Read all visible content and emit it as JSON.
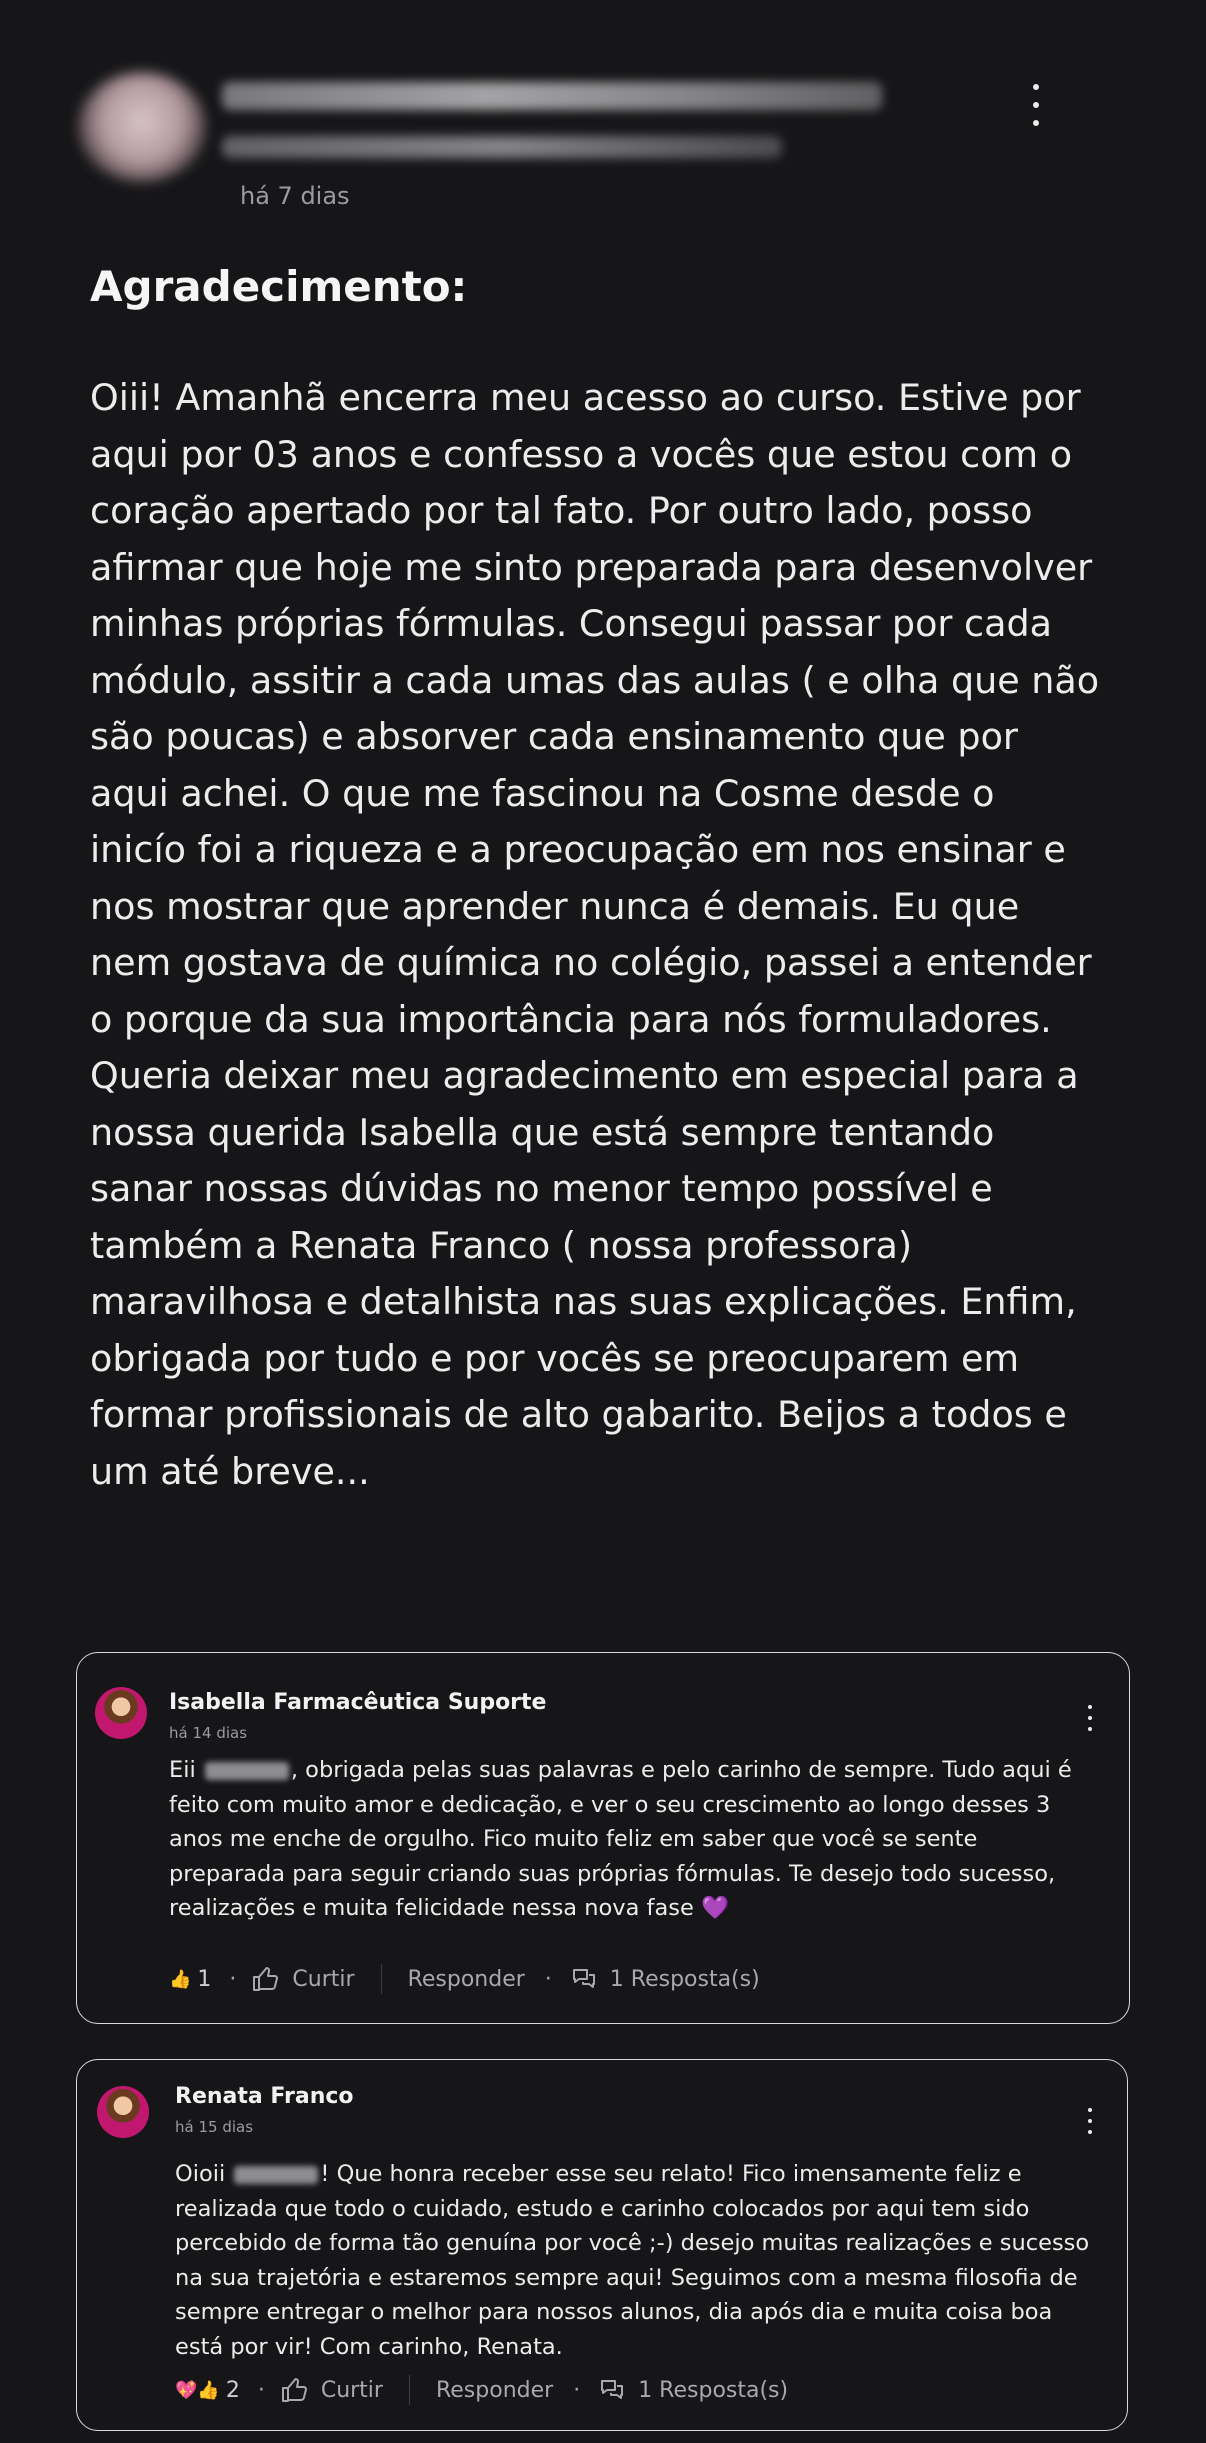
{
  "post": {
    "time": "há 7 dias",
    "title": "Agradecimento:",
    "body": "Oiii! Amanhã encerra meu acesso ao curso. Estive por aqui por 03 anos e confesso a vocês que estou com o coração apertado por tal fato. Por outro lado, posso afirmar que hoje me sinto preparada para desenvolver minhas próprias fórmulas. Consegui passar por cada módulo, assitir a cada umas das aulas ( e olha que não são poucas) e absorver cada ensinamento que por aqui achei. O que me fascinou na Cosme desde o inicío foi a riqueza e a preocupação em nos ensinar e nos mostrar que aprender nunca é demais. Eu que nem gostava de química no colégio, passei a entender o porque da sua importância para nós formuladores. Queria deixar meu agradecimento em especial para a nossa querida Isabella que está sempre tentando sanar nossas dúvidas no menor tempo possível e também a Renata Franco ( nossa professora) maravilhosa e detalhista nas suas explicações. Enfim, obrigada por tudo e por vocês se preocuparem em formar profissionais de alto gabarito. Beijos a todos e um até breve..."
  },
  "comments": [
    {
      "author": "Isabella Farmacêutica Suporte",
      "time": "há 14 dias",
      "text_start": "Eii",
      "text_rest": ", obrigada pelas suas palavras e pelo carinho de sempre. Tudo aqui é feito com muito amor e dedicação, e ver o seu crescimento ao longo desses 3 anos me enche de orgulho. Fico muito feliz em saber que você se sente preparada para seguir criando suas próprias fórmulas. Te desejo todo sucesso, realizações e muita felicidade nessa nova fase 💜",
      "reactions": "👍",
      "reaction_count": "1",
      "like_label": "Curtir",
      "reply_label": "Responder",
      "replies_label": "1 Resposta(s)"
    },
    {
      "author": "Renata Franco",
      "time": "há 15 dias",
      "text_start": "Oioii",
      "text_rest": "! Que honra receber esse seu relato! Fico imensamente feliz e realizada que todo o cuidado, estudo e carinho colocados por aqui tem sido percebido de forma tão genuína por você ;-) desejo muitas realizações e sucesso na sua trajetória e estaremos sempre aqui! Seguimos com a mesma filosofia de sempre entregar o melhor para nossos alunos, dia após dia e muita coisa boa está por vir! Com carinho, Renata.",
      "reactions": "💖👍",
      "reaction_count": "2",
      "like_label": "Curtir",
      "reply_label": "Responder",
      "replies_label": "1 Resposta(s)"
    }
  ],
  "icons": {
    "more": "kebab-vertical",
    "like": "thumbs-up-outline",
    "replies": "chat-bubbles-outline"
  },
  "colors": {
    "background": "#161618",
    "text": "#ececec",
    "muted": "#9b9ba0",
    "card_border": "#d9d9d9",
    "avatar_accent": "#c2176e"
  }
}
